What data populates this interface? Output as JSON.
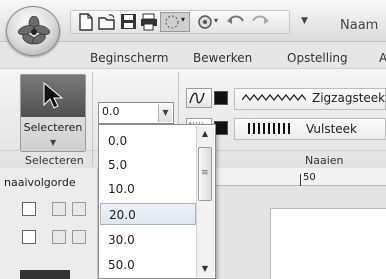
{
  "window": {
    "title": "Naam"
  },
  "qat": {
    "dropdown_glyph": "▾",
    "customize_glyph": "▼"
  },
  "tabs": [
    {
      "label": "Beginscherm"
    },
    {
      "label": "Bewerken"
    },
    {
      "label": "Opstelling"
    },
    {
      "label": "A"
    }
  ],
  "ribbon": {
    "select_button_label": "Selecteren",
    "select_group_label": "Selecteren",
    "stitch_group_label": "Naaien",
    "stitch_rows": [
      {
        "label": "Zigzagsteek",
        "color": "#111111"
      },
      {
        "label": "Vulsteek",
        "color": "#111111"
      }
    ]
  },
  "width_combo": {
    "value": "0.0"
  },
  "dropdown": {
    "options": [
      "0.0",
      "5.0",
      "10.0",
      "20.0",
      "30.0",
      "50.0"
    ],
    "selected_index": 3
  },
  "panel": {
    "title": "naaivolgorde"
  },
  "ruler": {
    "label": "50"
  },
  "colors": {
    "accent": "#dfe7ef",
    "ribbon_bg": "#e9e9e9"
  }
}
